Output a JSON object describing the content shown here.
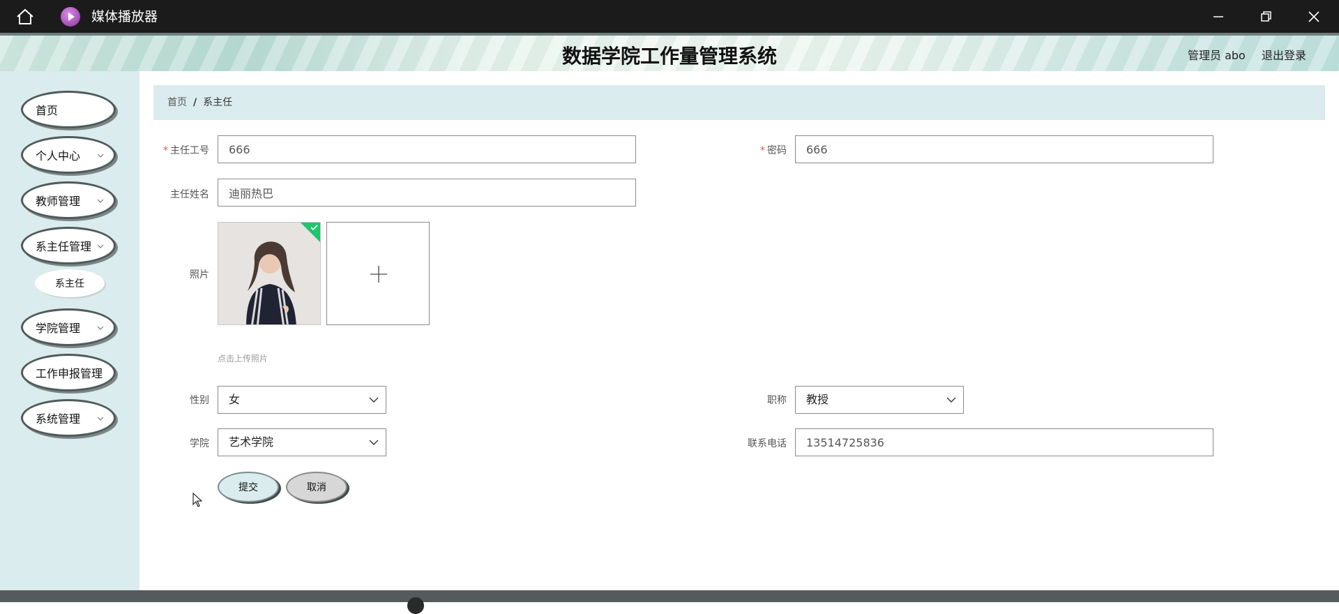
{
  "window": {
    "title": "媒体播放器",
    "icons": {
      "home": "home-icon",
      "app": "play-circle-icon",
      "minimize": "minimize-icon",
      "maximize": "restore-icon",
      "close": "close-icon"
    }
  },
  "header": {
    "title": "数据学院工作量管理系统",
    "user": "管理员 abo",
    "logout": "退出登录"
  },
  "sidebar": {
    "items": [
      {
        "label": "首页",
        "has_chevron": false
      },
      {
        "label": "个人中心",
        "has_chevron": true
      },
      {
        "label": "教师管理",
        "has_chevron": true
      },
      {
        "label": "系主任管理",
        "has_chevron": true
      },
      {
        "label": "学院管理",
        "has_chevron": true
      },
      {
        "label": "工作申报管理",
        "has_chevron": false
      },
      {
        "label": "系统管理",
        "has_chevron": true
      }
    ],
    "sub_item": "系主任"
  },
  "breadcrumb": {
    "home": "首页",
    "separator": "/",
    "current": "系主任"
  },
  "form": {
    "director_id": {
      "label": "主任工号",
      "required": true,
      "value": "666"
    },
    "password": {
      "label": "密码",
      "required": true,
      "value": "666"
    },
    "director_name": {
      "label": "主任姓名",
      "value": "迪丽热巴"
    },
    "photo": {
      "label": "照片",
      "hint": "点击上传照片",
      "uploaded": true
    },
    "gender": {
      "label": "性别",
      "value": "女"
    },
    "title": {
      "label": "职称",
      "value": "教授"
    },
    "college": {
      "label": "学院",
      "value": "艺术学院"
    },
    "phone": {
      "label": "联系电话",
      "value": "13514725836"
    }
  },
  "buttons": {
    "submit": "提交",
    "cancel": "取消"
  },
  "colors": {
    "accent_bg": "#dbecee",
    "required": "#f04a4a",
    "upload_ok": "#1fc46b",
    "titlebar": "#1b1b1b"
  }
}
